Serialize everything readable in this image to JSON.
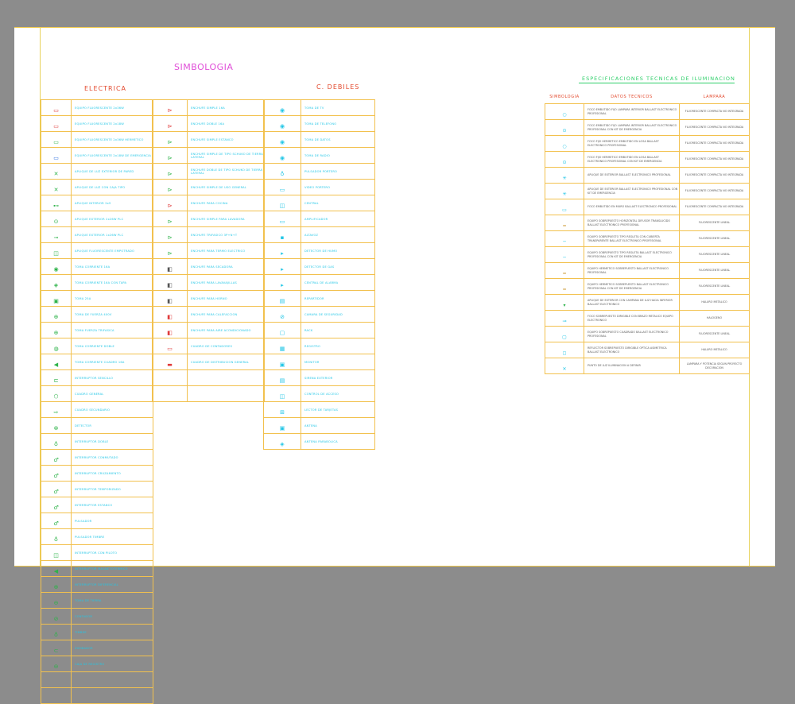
{
  "titles": {
    "simbologia": "SIMBOLOGIA",
    "electrica": "ELECTRICA",
    "c_debiles": "C. DEBILES",
    "especificaciones": "ESPECIFICACIONES TECNICAS DE ILUMINACION"
  },
  "colors": {
    "grid": "#f2c14e",
    "cyan": "#22c6e6",
    "magenta": "#e04fd8",
    "red": "#e34a2e",
    "green": "#2fcf6a"
  },
  "electrica_col1": [
    {
      "icon": "▭",
      "color": "#e03a3a",
      "text": "EQUIPO FLUORESCENTE 2x36W"
    },
    {
      "icon": "▭",
      "color": "#e03a3a",
      "text": "EQUIPO FLUORESCENTE 2x18W"
    },
    {
      "icon": "▭",
      "color": "#2fb34a",
      "text": "EQUIPO FLUORESCENTE 2x36W HERMETICO"
    },
    {
      "icon": "▭",
      "color": "#2f6fe0",
      "text": "EQUIPO FLUORESCENTE 2x18W DE EMERGENCIA"
    },
    {
      "icon": "✕",
      "color": "#2fb34a",
      "text": "APLIQUE DE LUZ EXTERIOR DE PARED"
    },
    {
      "icon": "✕",
      "color": "#2fb34a",
      "text": "APLIQUE DE LUZ CON CAJA TIPO"
    },
    {
      "icon": "⊷",
      "color": "#2fb34a",
      "text": "APLIQUE INTERIOR 2x9"
    },
    {
      "icon": "⊙",
      "color": "#2fb34a",
      "text": "APLIQUE EXTERIOR 2x26W PLC"
    },
    {
      "icon": "⊸",
      "color": "#2fb34a",
      "text": "APLIQUE EXTERIOR 1x26W PLC"
    },
    {
      "icon": "◫",
      "color": "#2fb34a",
      "text": "APLIQUE FLUORESCENTE EMPOTRADO"
    },
    {
      "icon": "◉",
      "color": "#2fb34a",
      "text": "TOMA CORRIENTE 16A"
    },
    {
      "icon": "◈",
      "color": "#2fb34a",
      "text": "TOMA CORRIENTE 16A CON TAPA"
    },
    {
      "icon": "▣",
      "color": "#2fb34a",
      "text": "TOMA 25A"
    },
    {
      "icon": "⊕",
      "color": "#2fb34a",
      "text": "TOMA DE FUERZA 400V"
    },
    {
      "icon": "⊕",
      "color": "#2fb34a",
      "text": "TOMA FUERZA TRIFASICA"
    },
    {
      "icon": "◍",
      "color": "#2fb34a",
      "text": "TOMA CORRIENTE DOBLE"
    },
    {
      "icon": "◀",
      "color": "#2fb34a",
      "text": "TOMA CORRIENTE CUADRO 16A"
    },
    {
      "icon": "⊏",
      "color": "#2fb34a",
      "text": "INTERRUPTOR SENCILLO"
    },
    {
      "icon": "⬡",
      "color": "#2fb34a",
      "text": "CUADRO GENERAL"
    },
    {
      "icon": "⇨",
      "color": "#2fb34a",
      "text": "CUADRO SECUNDARIO"
    },
    {
      "icon": "⊗",
      "color": "#2fb34a",
      "text": "DETECTOR"
    },
    {
      "icon": "♁",
      "color": "#2fb34a",
      "text": "INTERRUPTOR DOBLE"
    },
    {
      "icon": "♂",
      "color": "#2fb34a",
      "text": "INTERRUPTOR CONMUTADO"
    },
    {
      "icon": "♂",
      "color": "#2fb34a",
      "text": "INTERRUPTOR CRUZAMIENTO"
    },
    {
      "icon": "♂",
      "color": "#2fb34a",
      "text": "INTERRUPTOR TEMPORIZADO"
    },
    {
      "icon": "♂",
      "color": "#2fb34a",
      "text": "INTERRUPTOR ESTANCO"
    },
    {
      "icon": "♂",
      "color": "#2fb34a",
      "text": "PULSADOR"
    },
    {
      "icon": "♁",
      "color": "#2fb34a",
      "text": "PULSADOR TIMBRE"
    },
    {
      "icon": "◫",
      "color": "#2fb34a",
      "text": "INTERRUPTOR CON PILOTO"
    },
    {
      "icon": "◀",
      "color": "#2fb34a",
      "text": "INTERRUPTOR MAGNETOTERMICO"
    },
    {
      "icon": "⊕",
      "color": "#2fb34a",
      "text": "INTERRUPTOR DIFERENCIAL"
    },
    {
      "icon": "⊖",
      "color": "#2fb34a",
      "text": "TOMA DE TIERRA"
    },
    {
      "icon": "⊘",
      "color": "#2fb34a",
      "text": "CONTADOR"
    },
    {
      "icon": "♁",
      "color": "#2fb34a",
      "text": "TIMBRE"
    },
    {
      "icon": "⊂",
      "color": "#2fb34a",
      "text": "ZUMBADOR"
    },
    {
      "icon": "⊖",
      "color": "#2fb34a",
      "text": "CAJA DE REGISTRO"
    },
    {
      "icon": "",
      "color": "#2fb34a",
      "text": ""
    },
    {
      "icon": "",
      "color": "#2fb34a",
      "text": ""
    }
  ],
  "electrica_col2": [
    {
      "icon": "⊳",
      "color": "#e03a3a",
      "text": "ENCHUFE SIMPLE 16A"
    },
    {
      "icon": "⊳",
      "color": "#e03a3a",
      "text": "ENCHUFE DOBLE 16A"
    },
    {
      "icon": "⊳",
      "color": "#2fb34a",
      "text": "ENCHUFE SIMPLE ESTANCO"
    },
    {
      "icon": "⊳",
      "color": "#2fb34a",
      "text": "ENCHUFE SIMPLE DE TIPO SCHUKO DE TIERRA LATERAL"
    },
    {
      "icon": "⊳",
      "color": "#2fb34a",
      "text": "ENCHUFE DOBLE DE TIPO SCHUKO DE TIERRA LATERAL"
    },
    {
      "icon": "⊳",
      "color": "#2fb34a",
      "text": "ENCHUFE SIMPLE DE USO GENERAL"
    },
    {
      "icon": "⊳",
      "color": "#e03a3a",
      "text": "ENCHUFE PARA COCINA"
    },
    {
      "icon": "⊳",
      "color": "#2fb34a",
      "text": "ENCHUFE SIMPLE PARA LAVADORA"
    },
    {
      "icon": "⊳",
      "color": "#2fb34a",
      "text": "ENCHUFE TRIFASICO 3P+N+T"
    },
    {
      "icon": "⊳",
      "color": "#2fb34a",
      "text": "ENCHUFE PARA TERMO ELECTRICO"
    },
    {
      "icon": "◧",
      "color": "#555555",
      "text": "ENCHUFE PARA SECADORA"
    },
    {
      "icon": "◧",
      "color": "#555555",
      "text": "ENCHUFE PARA LAVAVAJILLAS"
    },
    {
      "icon": "◧",
      "color": "#555555",
      "text": "ENCHUFE PARA HORNO"
    },
    {
      "icon": "◧",
      "color": "#e03a3a",
      "text": "ENCHUFE PARA CALEFACCION"
    },
    {
      "icon": "◧",
      "color": "#e03a3a",
      "text": "ENCHUFE PARA AIRE ACONDICIONADO"
    },
    {
      "icon": "▭",
      "color": "#e03a3a",
      "text": "CUADRO DE CONTADORES"
    },
    {
      "icon": "▬",
      "color": "#e03a3a",
      "text": "CUADRO DE DISTRIBUCION GENERAL"
    },
    {
      "icon": "",
      "color": "#2fb34a",
      "text": ""
    },
    {
      "icon": "",
      "color": "#2fb34a",
      "text": ""
    }
  ],
  "debiles": [
    {
      "icon": "◉",
      "text": "TOMA DE TV"
    },
    {
      "icon": "◉",
      "text": "TOMA DE TELEFONO"
    },
    {
      "icon": "◉",
      "text": "TOMA DE DATOS"
    },
    {
      "icon": "◉",
      "text": "TOMA DE RADIO"
    },
    {
      "icon": "♁",
      "text": "PULSADOR PORTERO"
    },
    {
      "icon": "▭",
      "text": "VIDEO PORTERO"
    },
    {
      "icon": "◫",
      "text": "CENTRAL"
    },
    {
      "icon": "▭",
      "text": "AMPLIFICADOR"
    },
    {
      "icon": "▪",
      "text": "ALTAVOZ"
    },
    {
      "icon": "▸",
      "text": "DETECTOR DE HUMO"
    },
    {
      "icon": "▸",
      "text": "DETECTOR DE GAS"
    },
    {
      "icon": "▸",
      "text": "CENTRAL DE ALARMA"
    },
    {
      "icon": "▤",
      "text": "REPARTIDOR"
    },
    {
      "icon": "⊘",
      "text": "CAMARA DE SEGURIDAD"
    },
    {
      "icon": "▢",
      "text": "RACK"
    },
    {
      "icon": "▦",
      "text": "REGISTRO"
    },
    {
      "icon": "▣",
      "text": "MONITOR"
    },
    {
      "icon": "▤",
      "text": "SIRENA EXTERIOR"
    },
    {
      "icon": "◫",
      "text": "CONTROL DE ACCESO"
    },
    {
      "icon": "⊞",
      "text": "LECTOR DE TARJETAS"
    },
    {
      "icon": "▣",
      "text": "ANTENA"
    },
    {
      "icon": "◈",
      "text": "ANTENA PARABOLICA"
    }
  ],
  "spec": {
    "headers": [
      "SIMBOLOGIA",
      "DATOS TECNICOS",
      "LAMPARA"
    ],
    "rows": [
      {
        "icon": "○",
        "data": "FOCO EMBUTIDO FIJO LAMPARA INTERIOR BALLAST ELECTRONICO PROFESIONAL",
        "lamp": "FLUORESCENTE COMPACTA NO INTEGRADA"
      },
      {
        "icon": "⊙",
        "data": "FOCO EMBUTIDO FIJO LAMPARA INTERIOR BALLAST ELECTRONICO PROFESIONAL CON KIT DE EMERGENCIA",
        "lamp": "FLUORESCENTE COMPACTA NO INTEGRADA"
      },
      {
        "icon": "○",
        "data": "FOCO FIJO HERMETICO EMBUTIDO EN LOSA BALLAST ELECTRONICO PROFESIONAL",
        "lamp": "FLUORESCENTE COMPACTA NO INTEGRADA"
      },
      {
        "icon": "⊙",
        "data": "FOCO FIJO HERMETICO EMBUTIDO EN LOSA BALLAST ELECTRONICO PROFESIONAL CON KIT DE EMERGENCIA",
        "lamp": "FLUORESCENTE COMPACTA NO INTEGRADA"
      },
      {
        "icon": "✳",
        "data": "APLIQUE DE EXTERIOR BALLAST ELECTRONICO PROFESIONAL",
        "lamp": "FLUORESCENTE COMPACTA NO INTEGRADA"
      },
      {
        "icon": "✳",
        "data": "APLIQUE DE EXTERIOR BALLAST ELECTRONICO PROFESIONAL CON KIT DE EMERGENCIA",
        "lamp": "FLUORESCENTE COMPACTA NO INTEGRADA"
      },
      {
        "icon": "▭",
        "data": "FOCO EMBUTIDO EN MURO BALLAST ELECTRONICO PROFESIONAL",
        "lamp": "FLUORESCENTE COMPACTA NO INTEGRADA"
      },
      {
        "icon": "━",
        "data": "EQUIPO SOBREPUESTO HORIZONTAL DIFUSOR TRANSLUCIDO BALLAST ELECTRONICO PROFESIONAL",
        "lamp": "FLUORESCENTE LINEAL"
      },
      {
        "icon": "─",
        "data": "EQUIPO SOBREPUESTO TIPO REGLETA CON CUBIERTA TRANSPARENTE BALLAST ELECTRONICO PROFESIONAL",
        "lamp": "FLUORESCENTE LINEAL"
      },
      {
        "icon": "─",
        "data": "EQUIPO SOBREPUESTO TIPO REGLETA BALLAST ELECTRONICO PROFESIONAL CON KIT DE EMERGENCIA",
        "lamp": "FLUORESCENTE LINEAL"
      },
      {
        "icon": "━",
        "data": "EQUIPO HERMETICO SOBREPUESTO BALLAST ELECTRONICO PROFESIONAL",
        "lamp": "FLUORESCENTE LINEAL"
      },
      {
        "icon": "━",
        "data": "EQUIPO HERMETICO SOBREPUESTO BALLAST ELECTRONICO PROFESIONAL CON KIT DE EMERGENCIA",
        "lamp": "FLUORESCENTE LINEAL"
      },
      {
        "icon": "▾",
        "data": "APLIQUE DE EXTERIOR CON CAMPANA DE LUZ HACIA INFERIOR BALLAST ELECTRONICO",
        "lamp": "HALURO METALICO"
      },
      {
        "icon": "⊸",
        "data": "FOCO SOBREPUESTO DIRIGIBLE CON BRAZO METALICO EQUIPO ELECTRONICO",
        "lamp": "HALOGENO"
      },
      {
        "icon": "▢",
        "data": "EQUIPO SOBREPUESTO CUADRADO BALLAST ELECTRONICO PROFESIONAL",
        "lamp": "FLUORESCENTE LINEAL"
      },
      {
        "icon": "◻",
        "data": "REFLECTOR SOBREPUESTO DIRIGIBLE OPTICA ASIMETRICA BALLAST ELECTRONICO",
        "lamp": "HALURO METALICO"
      },
      {
        "icon": "✕",
        "data": "PUNTO DE LUZ ILUMINACION A DEFINIR",
        "lamp": "LAMPARA Y POTENCIA SEGUN PROYECTO DECORACION"
      }
    ]
  }
}
